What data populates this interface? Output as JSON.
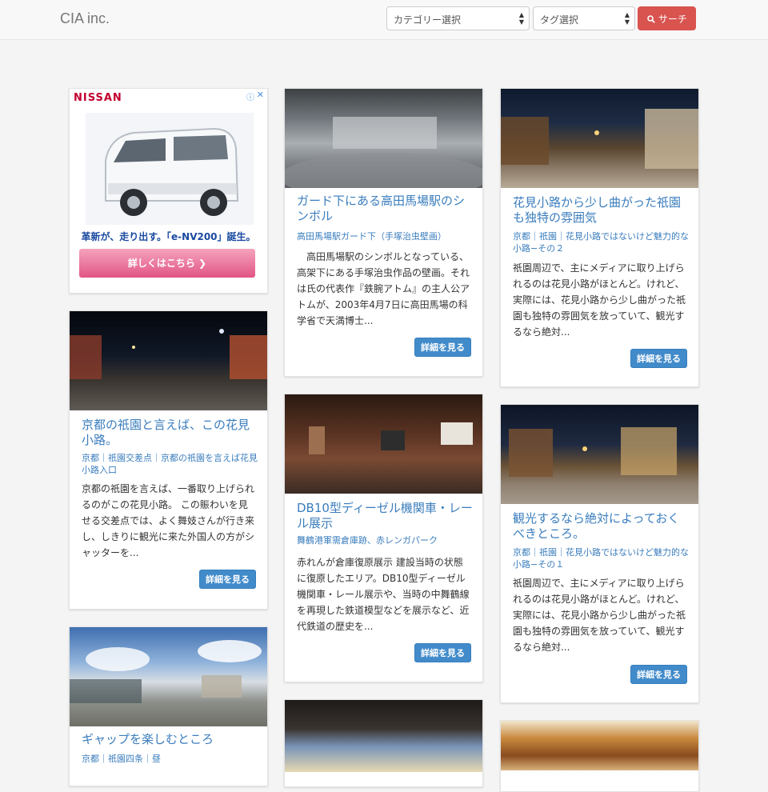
{
  "header": {
    "brand": "CIA inc.",
    "category_select": "カテゴリー選択",
    "tag_select": "タグ選択",
    "search_label": "サーチ",
    "search_color": "#d9534f"
  },
  "ad": {
    "brand": "NISSAN",
    "copy": "革新が、走り出す。「e-NV200」誕生。",
    "button": "詳しくはこちら ❯",
    "info_icon": "ⓘ",
    "close_icon": "✕"
  },
  "more_label": "詳細を見る",
  "cards": [
    {
      "title": "ガード下にある高田馬場駅のシンボル",
      "tags": "高田馬場駅ガード下（手塚治虫壁画）",
      "body": "　高田馬場駅のシンボルとなっている、高架下にある手塚治虫作品の壁画。それは氏の代表作『鉄腕アトム』の主人公アトムが、2003年4月7日に高田馬場の科学省で天満博士..."
    },
    {
      "title": "花見小路から少し曲がった祇園も独特の雰囲気",
      "tags": "京都｜祇園｜花見小路ではないけど魅力的な小路−その２",
      "body": "祇園周辺で、主にメディアに取り上げられるのは花見小路がほとんど。けれど、実際には、花見小路から少し曲がった祇園も独特の雰囲気を放っていて、観光するなら絶対..."
    },
    {
      "title": "京都の祇園と言えば、この花見小路。",
      "tags": "京都｜祇園交差点｜京都の祇園を言えば花見小路入口",
      "body": "京都の祇園を言えば、一番取り上げられるのがこの花見小路。 この賑わいを見せる交差点では、よく舞妓さんが行き来し、しきりに観光に来た外国人の方がシャッターを..."
    },
    {
      "title": "DB10型ディーゼル機関車・レール展示",
      "tags": "舞鶴港軍需倉庫跡、赤レンガパーク",
      "body": "赤れんが倉庫復原展示 建設当時の状態に復原したエリア。DB10型ディーゼル機関車・レール展示や、当時の中舞鶴線を再現した鉄道模型などを展示など、近代鉄道の歴史を..."
    },
    {
      "title": "観光するなら絶対によっておくべきところ。",
      "tags": "京都｜祇園｜花見小路ではないけど魅力的な小路−その１",
      "body": "祇園周辺で、主にメディアに取り上げられるのは花見小路がほとんど。けれど、実際には、花見小路から少し曲がった祇園も独特の雰囲気を放っていて、観光するなら絶対..."
    },
    {
      "title": "ギャップを楽しむところ",
      "tags": "京都｜祇園四条｜昼",
      "body": ""
    }
  ]
}
